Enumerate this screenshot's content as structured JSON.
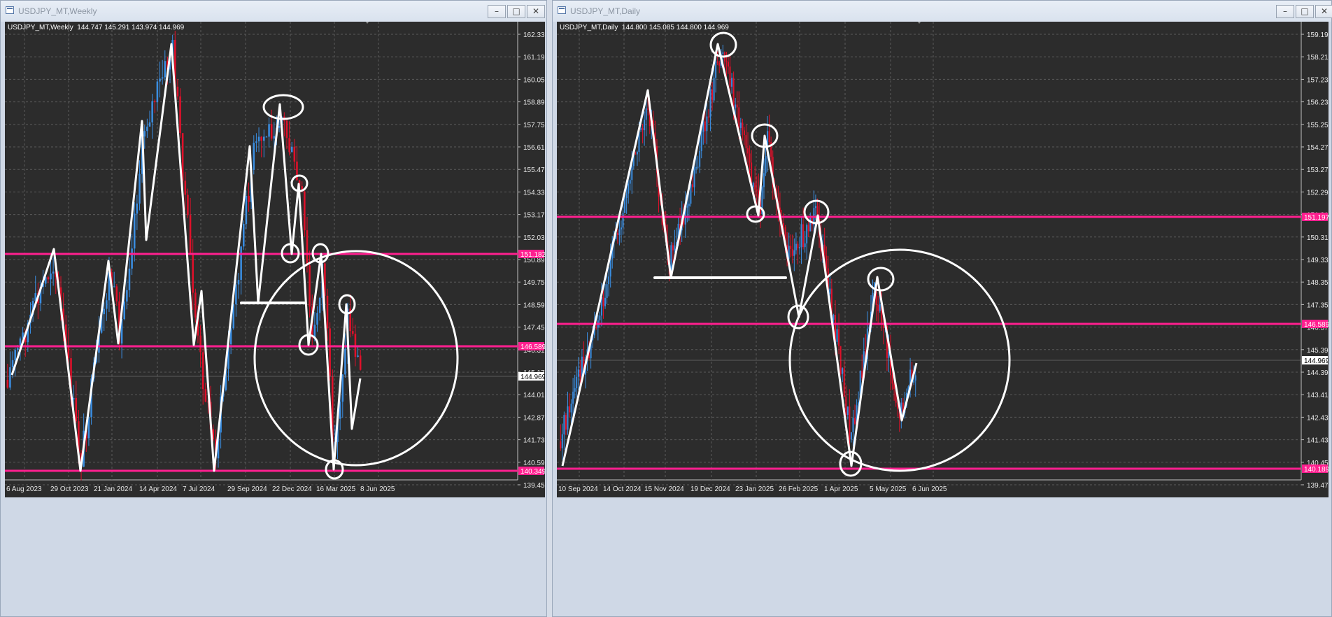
{
  "windows": [
    {
      "title": "USDJPY_MT,Weekly",
      "info": "USDJPY_MT,Weekly  144.747 145.291 143.974 144.969",
      "price_labels": [
        "162.330",
        "161.190",
        "160.050",
        "158.890",
        "157.750",
        "156.610",
        "155.470",
        "154.330",
        "153.170",
        "152.030",
        "150.890",
        "149.750",
        "148.590",
        "147.450",
        "146.310",
        "145.170",
        "144.010",
        "142.870",
        "141.730",
        "140.590",
        "139.450"
      ],
      "date_labels": [
        "6 Aug 2023",
        "29 Oct 2023",
        "21 Jan 2024",
        "14 Apr 2024",
        "7 Jul 2024",
        "29 Sep 2024",
        "22 Dec 2024",
        "16 Mar 2025",
        "8 Jun 2025"
      ],
      "level_tags": [
        "151.182",
        "146.589",
        "140.349"
      ],
      "current_price": "144.969",
      "colors": {
        "background": "#2c2c2c",
        "bull": "#3a8de0",
        "bear": "#e0102a",
        "level": "#ff1f8f",
        "drawing": "#ffffff",
        "grid": "#5a5a5a"
      }
    },
    {
      "title": "USDJPY_MT,Daily",
      "info": "USDJPY_MT,Daily  144.800 145.085 144.800 144.969",
      "price_labels": [
        "159.190",
        "158.210",
        "157.230",
        "156.230",
        "155.250",
        "154.270",
        "153.270",
        "152.290",
        "151.310",
        "150.310",
        "149.330",
        "148.350",
        "147.350",
        "146.370",
        "145.390",
        "144.390",
        "143.410",
        "142.430",
        "141.430",
        "140.450",
        "139.470"
      ],
      "date_labels": [
        "10 Sep 2024",
        "14 Oct 2024",
        "15 Nov 2024",
        "19 Dec 2024",
        "23 Jan 2025",
        "26 Feb 2025",
        "1 Apr 2025",
        "5 May 2025",
        "6 Jun 2025"
      ],
      "level_tags": [
        "151.197",
        "146.589",
        "140.189"
      ],
      "current_price": "144.969",
      "colors": {
        "background": "#2c2c2c",
        "bull": "#3a8de0",
        "bear": "#e0102a",
        "level": "#ff1f8f",
        "drawing": "#ffffff",
        "grid": "#5a5a5a"
      }
    }
  ],
  "buttons": {
    "minimize": "–",
    "maximize": "□",
    "close": "✕"
  }
}
